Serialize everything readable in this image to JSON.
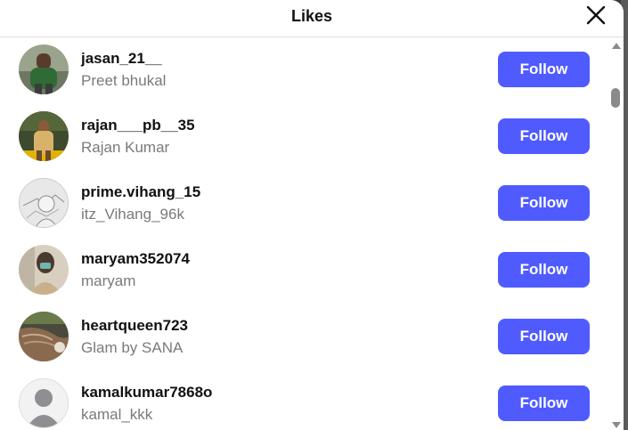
{
  "dialog": {
    "title": "Likes",
    "close_icon": "close-icon"
  },
  "colors": {
    "follow_button": "#4f5bff",
    "secondary_text": "#7a7a7a"
  },
  "likes": [
    {
      "username": "jasan_21__",
      "fullname": "Preet bhukal",
      "button": "Follow",
      "avatar": "photo-man-green-shirt"
    },
    {
      "username": "rajan___pb__35",
      "fullname": "Rajan Kumar",
      "button": "Follow",
      "avatar": "photo-man-yellow"
    },
    {
      "username": "prime.vihang_15",
      "fullname": "itz_Vihang_96k",
      "button": "Follow",
      "avatar": "sketch-grey"
    },
    {
      "username": "maryam352074",
      "fullname": "maryam",
      "button": "Follow",
      "avatar": "photo-woman-mask"
    },
    {
      "username": "heartqueen723",
      "fullname": "Glam by SANA",
      "button": "Follow",
      "avatar": "photo-hair"
    },
    {
      "username": "kamalkumar7868o",
      "fullname": "kamal_kkk",
      "button": "Follow",
      "avatar": "default-user-icon"
    }
  ]
}
